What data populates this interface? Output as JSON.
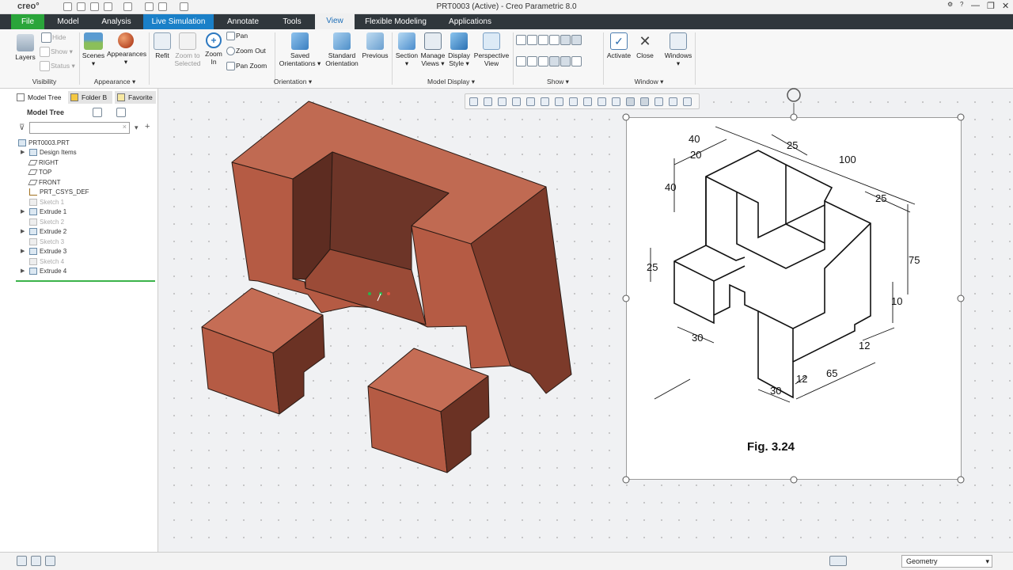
{
  "app": {
    "logo": "creo°",
    "window_title": "PRT0003 (Active) - Creo Parametric 8.0",
    "minimize": "—",
    "restore": "❐",
    "close": "✕"
  },
  "tabs": [
    "File",
    "Model",
    "Analysis",
    "Live Simulation",
    "Annotate",
    "Tools",
    "View",
    "Flexible Modeling",
    "Applications"
  ],
  "active_tab": "View",
  "ribbon": {
    "visibility": {
      "hide": "Hide",
      "show": "Show",
      "status": "Status",
      "layers": "Layers",
      "group": "Visibility"
    },
    "appearance": {
      "scenes": "Scenes",
      "appearances": "Appearances",
      "group": "Appearance"
    },
    "orientation": {
      "refit": "Refit",
      "zoom_selected_1": "Zoom to",
      "zoom_selected_2": "Selected",
      "zoom_in_1": "Zoom",
      "zoom_in_2": "In",
      "pan": "Pan",
      "zoom_out": "Zoom Out",
      "pan_zoom": "Pan Zoom",
      "saved_1": "Saved",
      "saved_2": "Orientations",
      "standard_1": "Standard",
      "standard_2": "Orientation",
      "previous": "Previous",
      "group": "Orientation"
    },
    "model_display": {
      "section": "Section",
      "manage_1": "Manage",
      "manage_2": "Views",
      "display_1": "Display",
      "display_2": "Style",
      "perspective_1": "Perspective",
      "perspective_2": "View",
      "group": "Model Display"
    },
    "show": {
      "group": "Show"
    },
    "window": {
      "activate": "Activate",
      "close": "Close",
      "windows": "Windows",
      "group": "Window"
    }
  },
  "panel": {
    "tabs": [
      "Model Tree",
      "Folder B",
      "Favorite"
    ],
    "title": "Model Tree",
    "filter_placeholder": "",
    "tree": [
      {
        "label": "PRT0003.PRT",
        "state": "normal"
      },
      {
        "label": "Design Items",
        "state": "normal"
      },
      {
        "label": "RIGHT",
        "state": "normal"
      },
      {
        "label": "TOP",
        "state": "normal"
      },
      {
        "label": "FRONT",
        "state": "normal"
      },
      {
        "label": "PRT_CSYS_DEF",
        "state": "normal"
      },
      {
        "label": "Sketch 1",
        "state": "dim"
      },
      {
        "label": "Extrude 1",
        "state": "normal"
      },
      {
        "label": "Sketch 2",
        "state": "dim"
      },
      {
        "label": "Extrude 2",
        "state": "normal"
      },
      {
        "label": "Sketch 3",
        "state": "dim"
      },
      {
        "label": "Extrude 3",
        "state": "normal"
      },
      {
        "label": "Sketch 4",
        "state": "dim"
      },
      {
        "label": "Extrude 4",
        "state": "normal"
      }
    ]
  },
  "drawing": {
    "caption": "Fig. 3.24",
    "dims": {
      "d40a": "40",
      "d20": "20",
      "d25a": "25",
      "d100": "100",
      "d40b": "40",
      "d25b": "25",
      "d75": "75",
      "d25c": "25",
      "d10": "10",
      "d30a": "30",
      "d12a": "12",
      "d30b": "30",
      "d12b": "12",
      "d65": "65"
    }
  },
  "status": {
    "filter": "Geometry"
  },
  "colors": {
    "model": "#b8614a",
    "model_dark": "#6b3224",
    "file_tab": "#2aa53a",
    "tabbar": "#30373c"
  }
}
